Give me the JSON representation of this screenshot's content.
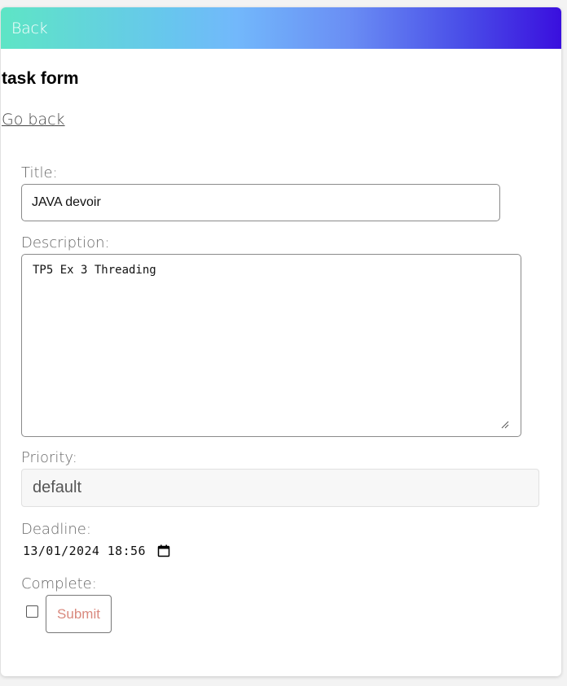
{
  "topbar": {
    "back_label": "Back"
  },
  "page": {
    "title": "task form",
    "go_back_label": "Go back"
  },
  "form": {
    "title_label": "Title:",
    "title_value": "JAVA devoir",
    "description_label": "Description:",
    "description_value": "TP5 Ex 3 Threading",
    "priority_label": "Priority:",
    "priority_value": "default",
    "deadline_label": "Deadline:",
    "deadline_value": "13/01/2024 18:56",
    "complete_label": "Complete:",
    "complete_checked": false,
    "submit_label": "Submit"
  },
  "icons": {
    "calendar": "calendar-icon",
    "resize": "resize-grip-icon"
  },
  "colors": {
    "gradient_start": "#5ee5c5",
    "gradient_end": "#3a0fde",
    "submit_text": "#d9897e"
  }
}
